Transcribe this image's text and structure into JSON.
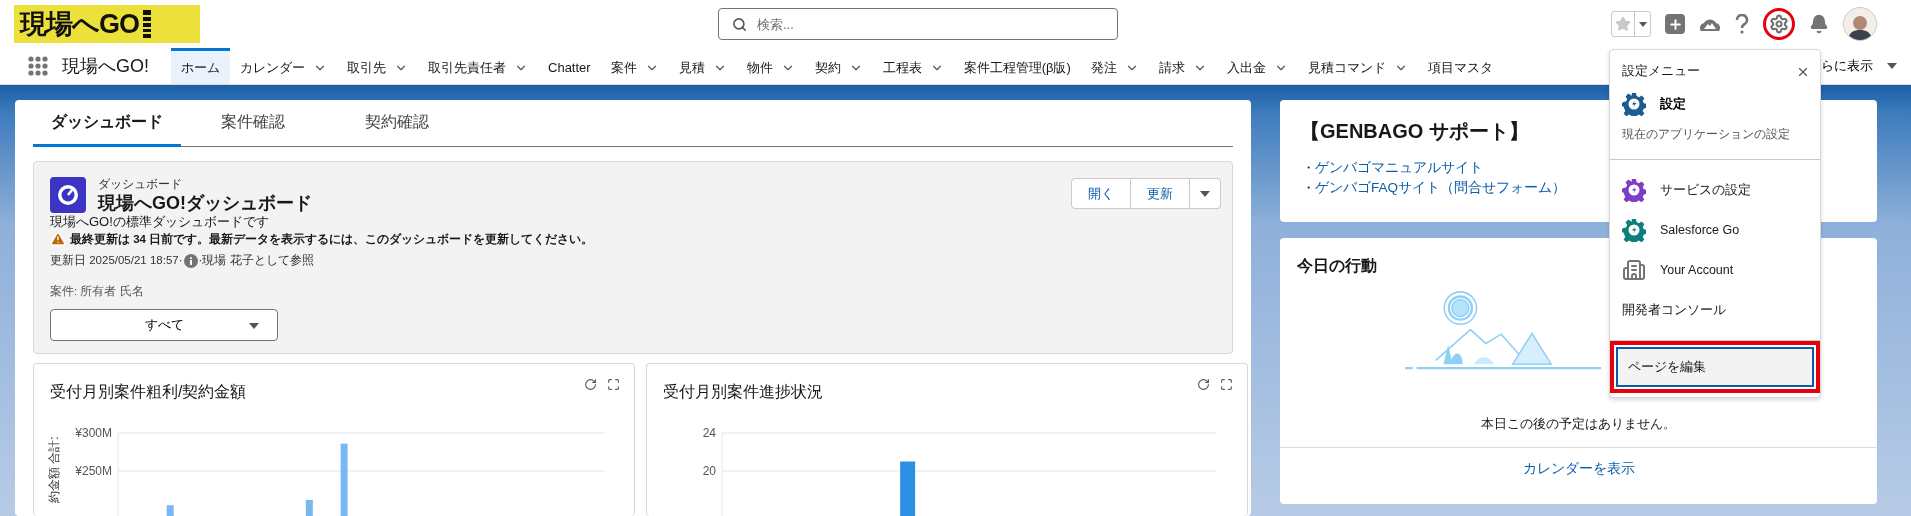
{
  "header": {
    "logo": "現場へGO",
    "search": {
      "placeholder": "検索..."
    },
    "icons": [
      {
        "kind": "favorite",
        "highlighted": false
      },
      {
        "kind": "add",
        "highlighted": false
      },
      {
        "kind": "guidance",
        "highlighted": false
      },
      {
        "kind": "help",
        "highlighted": false
      },
      {
        "kind": "setup",
        "highlighted": true
      },
      {
        "kind": "notifications",
        "highlighted": false
      },
      {
        "kind": "avatar",
        "highlighted": false
      }
    ]
  },
  "nav": {
    "app_name": "現場へGO!",
    "items": [
      {
        "label": "ホーム",
        "selected": true,
        "has_menu": false
      },
      {
        "label": "カレンダー",
        "selected": false,
        "has_menu": true
      },
      {
        "label": "取引先",
        "selected": false,
        "has_menu": true
      },
      {
        "label": "取引先責任者",
        "selected": false,
        "has_menu": true
      },
      {
        "label": "Chatter",
        "selected": false,
        "has_menu": false
      },
      {
        "label": "案件",
        "selected": false,
        "has_menu": true
      },
      {
        "label": "見積",
        "selected": false,
        "has_menu": true
      },
      {
        "label": "物件",
        "selected": false,
        "has_menu": true
      },
      {
        "label": "契約",
        "selected": false,
        "has_menu": true
      },
      {
        "label": "工程表",
        "selected": false,
        "has_menu": true
      },
      {
        "label": "案件工程管理(β版)",
        "selected": false,
        "has_menu": false
      },
      {
        "label": "発注",
        "selected": false,
        "has_menu": true
      },
      {
        "label": "請求",
        "selected": false,
        "has_menu": true
      },
      {
        "label": "入出金",
        "selected": false,
        "has_menu": true
      },
      {
        "label": "見積コマンド",
        "selected": false,
        "has_menu": true
      },
      {
        "label": "項目マスタ",
        "selected": false,
        "has_menu": false
      }
    ],
    "more": "らに表示"
  },
  "setup_menu": {
    "title": "設定メニュー",
    "groups": [
      [
        {
          "kind": "setup",
          "label": "設定",
          "description": "現在のアプリケーションの設定",
          "color": "#1c5c8f",
          "focused": false,
          "highlighted": false
        }
      ],
      [
        {
          "kind": "gear",
          "label": "サービスの設定",
          "color": "#7e3dc6",
          "focused": false,
          "highlighted": false
        },
        {
          "kind": "gear",
          "label": "Salesforce Go",
          "color": "#0b7f7a",
          "focused": false,
          "highlighted": false
        },
        {
          "kind": "building",
          "label": "Your Account",
          "focused": false,
          "highlighted": false
        },
        {
          "kind": "plain",
          "label": "開発者コンソール",
          "focused": false,
          "highlighted": false
        }
      ],
      [
        {
          "kind": "plain",
          "label": "ページを編集",
          "focused": true,
          "highlighted": true
        }
      ]
    ]
  },
  "tabs": [
    {
      "label": "ダッシュボード",
      "selected": true
    },
    {
      "label": "案件確認",
      "selected": false
    },
    {
      "label": "契約確認",
      "selected": false
    }
  ],
  "dashboard": {
    "type_label": "ダッシュボード",
    "title": "現場へGO!ダッシュボード",
    "description": "現場へGO!の標準ダッシュボードです",
    "warning": "最終更新は 34 日前です。最新データを表示するには、このダッシュボードを更新してください。",
    "updated": "更新日 2025/05/21 18:57·",
    "viewing_as": "·現場 花子として参照",
    "filter": {
      "label": "案件: 所有者 氏名",
      "value": "すべて"
    },
    "buttons": [
      "開く",
      "更新"
    ]
  },
  "charts": [
    {
      "title": "受付月別案件粗利/契約金額",
      "chart_data": {
        "type": "bar",
        "ylabel": "約金額 合計:",
        "ylim": [
          0,
          300
        ],
        "yticks": [
          {
            "value": 250,
            "label": "¥250M"
          },
          {
            "value": 300,
            "label": "¥300M"
          }
        ],
        "series": [
          {
            "color": "#78b8f0",
            "values": [
              null,
              205,
              null,
              null,
              null,
              212,
              286,
              null,
              null,
              null,
              null,
              null,
              null,
              null
            ]
          }
        ]
      }
    },
    {
      "title": "受付月別案件進捗状況",
      "chart_data": {
        "type": "bar",
        "ylim": [
          0,
          24
        ],
        "yticks": [
          20,
          24
        ],
        "series": [
          {
            "color": "#2e8fe6",
            "values": [
              null,
              null,
              null,
              null,
              21,
              null,
              null,
              null,
              null,
              null,
              null,
              null
            ]
          }
        ]
      }
    }
  ],
  "support": {
    "title": "【GENBAGO サポート】",
    "links": [
      {
        "bullet": "・",
        "label": "ゲンバゴマニュアルサイト"
      },
      {
        "bullet": "・",
        "label": "ゲンバゴFAQサイト（問合せフォーム）"
      }
    ]
  },
  "today": {
    "title": "今日の行動",
    "empty_message": "本日この後の予定はありません。",
    "link": "カレンダーを表示"
  }
}
